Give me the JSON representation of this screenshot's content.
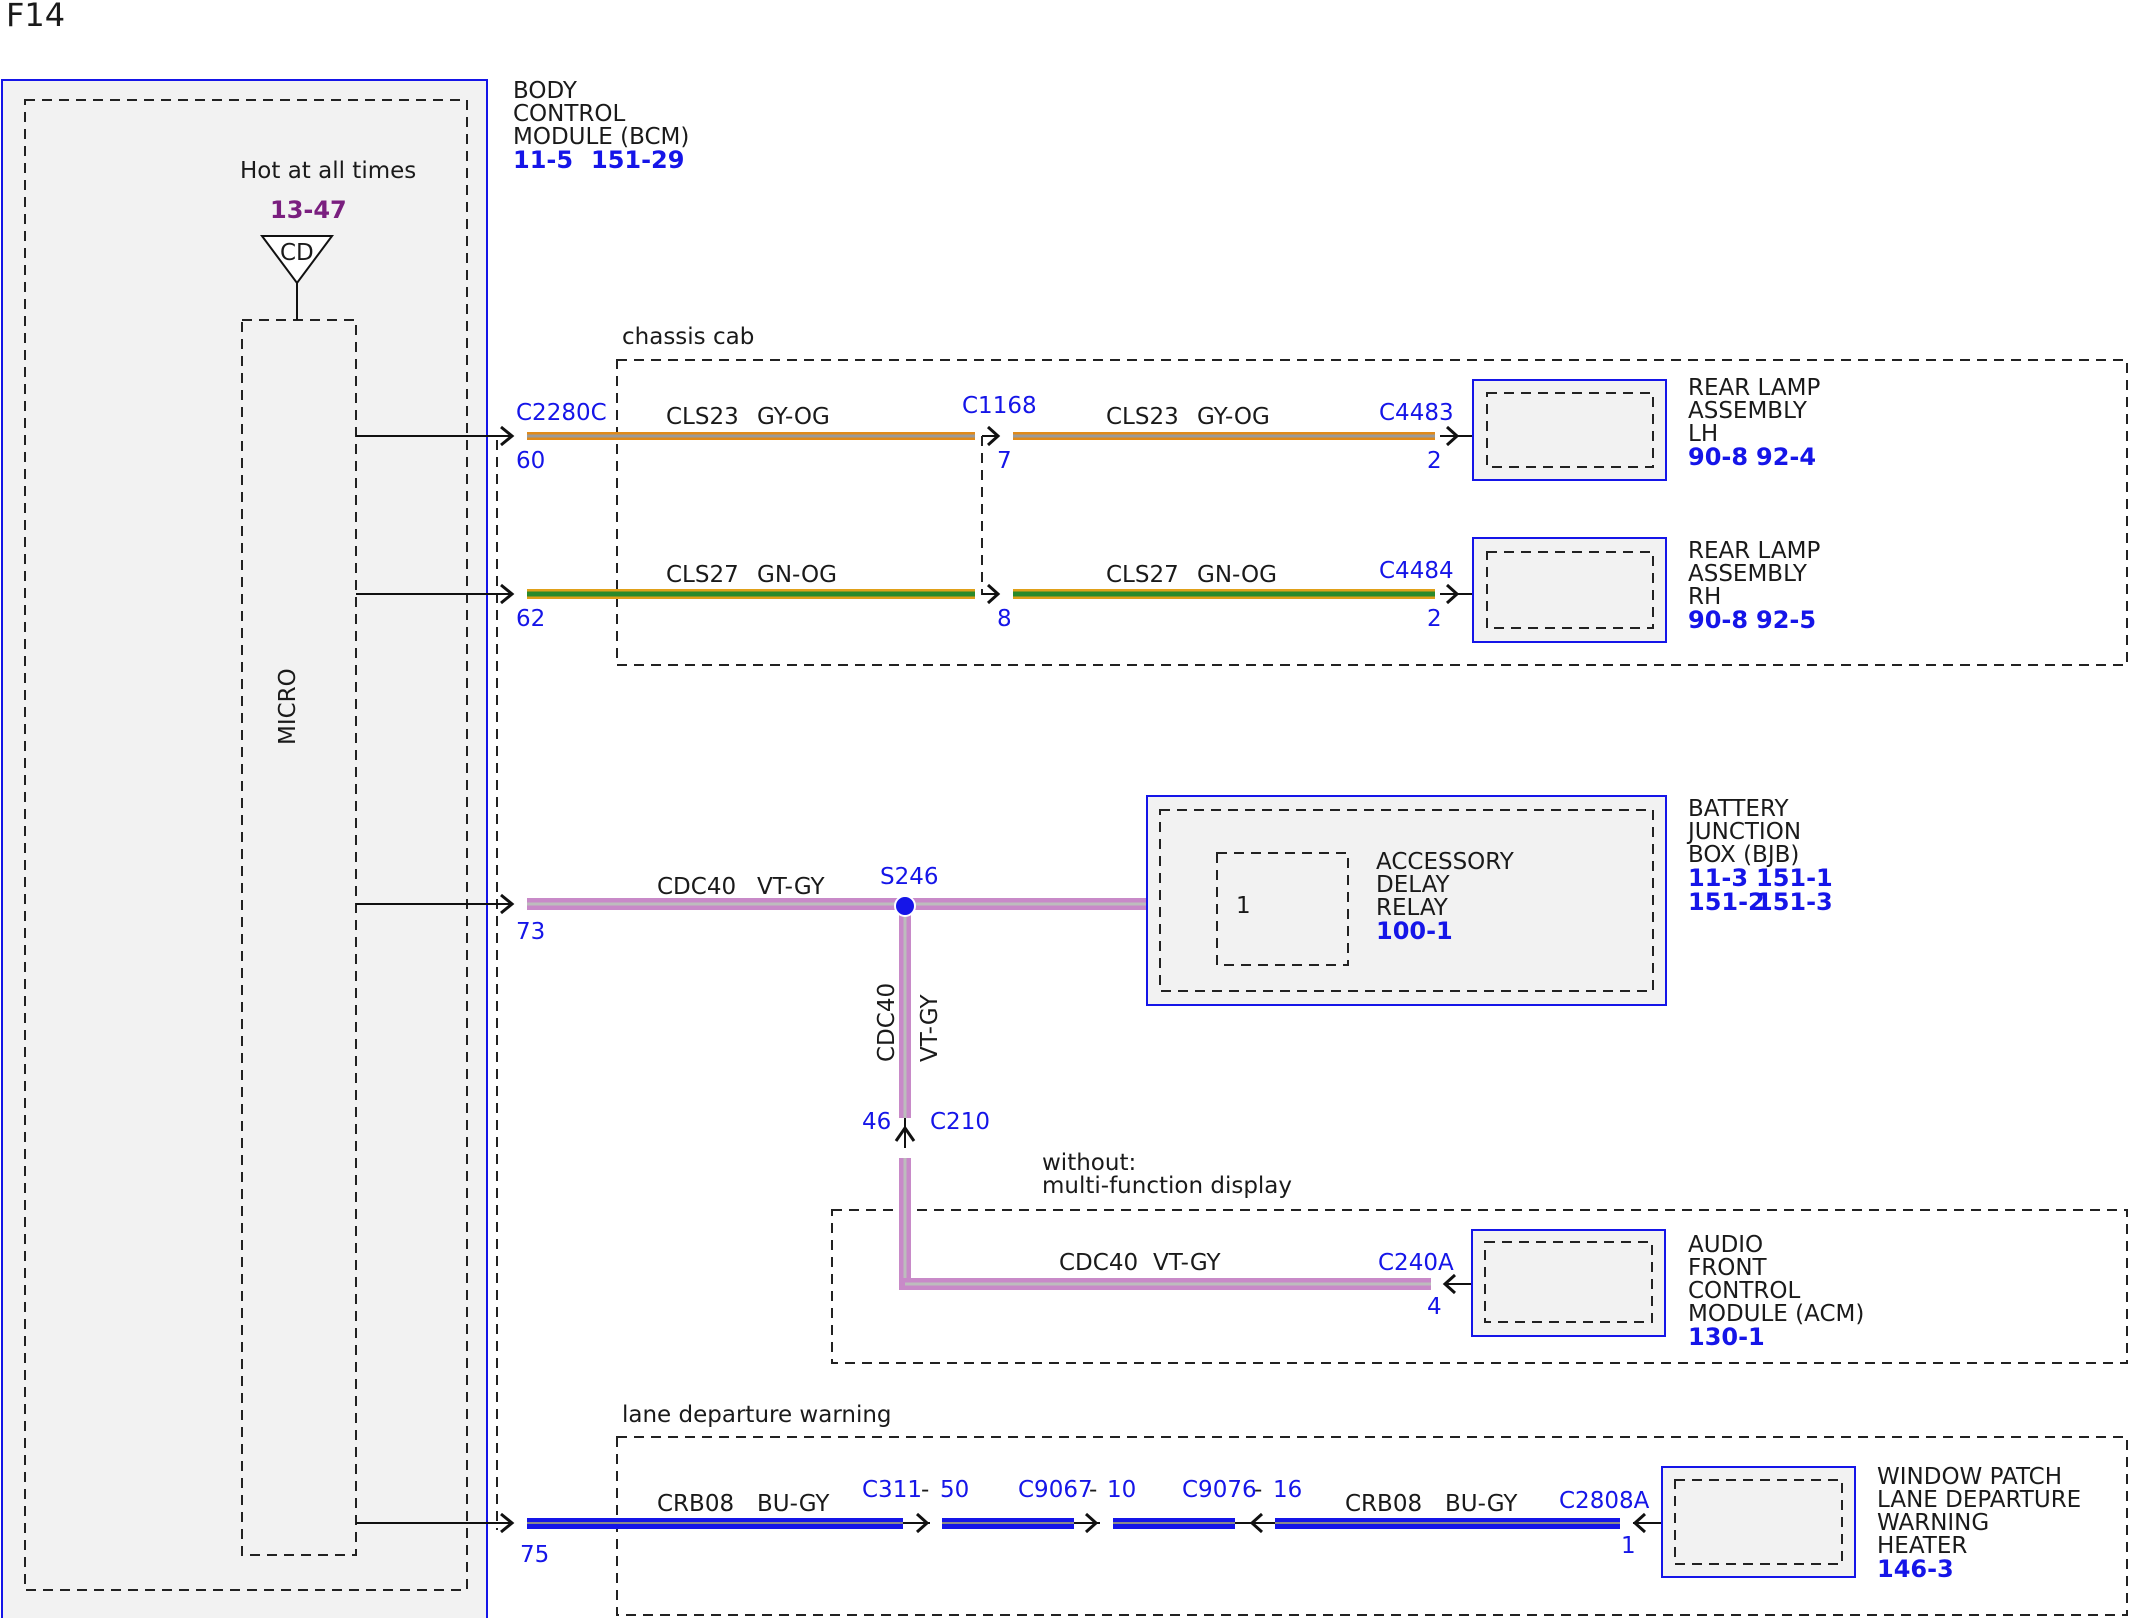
{
  "page_id": "F14",
  "bcm": {
    "title_lines": [
      "BODY",
      "CONTROL",
      "MODULE (BCM)"
    ],
    "refs": [
      "11-5",
      "151-29"
    ],
    "hot_label": "Hot at all times",
    "hot_ref": "13-47",
    "fuse_label": "CD",
    "micro_label": "MICRO"
  },
  "zones": {
    "chassis": "chassis cab",
    "without_lines": [
      "without:",
      "multi-function display"
    ],
    "lane": "lane departure warning"
  },
  "circuits": {
    "cls23": {
      "name": "CLS23",
      "color": "GY-OG"
    },
    "cls27": {
      "name": "CLS27",
      "color": "GN-OG"
    },
    "cdc40": {
      "name": "CDC40",
      "color": "VT-GY"
    },
    "crb08": {
      "name": "CRB08",
      "color": "BU-GY"
    }
  },
  "connectors": {
    "c2280c": "C2280C",
    "c1168": "C1168",
    "c4483": "C4483",
    "c4484": "C4484",
    "s246": "S246",
    "c210": "C210",
    "c240a": "C240A",
    "c311": "C311",
    "c9067": "C9067",
    "c9076": "C9076",
    "c2808a": "C2808A",
    "dash": "-"
  },
  "pins": {
    "p60": "60",
    "p62": "62",
    "p73": "73",
    "p75": "75",
    "p7": "7",
    "p8": "8",
    "p2a": "2",
    "p2b": "2",
    "p46": "46",
    "p4": "4",
    "p1": "1",
    "p50": "50",
    "p10": "10",
    "p16": "16",
    "relay_pin": "1"
  },
  "components": {
    "rear_lh": {
      "lines": [
        "REAR LAMP",
        "ASSEMBLY",
        "LH"
      ],
      "refs": [
        "90-8",
        "92-4"
      ]
    },
    "rear_rh": {
      "lines": [
        "REAR LAMP",
        "ASSEMBLY",
        "RH"
      ],
      "refs": [
        "90-8",
        "92-5"
      ]
    },
    "bjb": {
      "lines": [
        "BATTERY",
        "JUNCTION",
        "BOX (BJB)"
      ],
      "refs": [
        "11-3",
        "151-1",
        "151-2",
        "151-3"
      ]
    },
    "relay": {
      "lines": [
        "ACCESSORY",
        "DELAY",
        "RELAY"
      ],
      "ref": "100-1"
    },
    "acm": {
      "lines": [
        "AUDIO",
        "FRONT",
        "CONTROL",
        "MODULE (ACM)"
      ],
      "ref": "130-1"
    },
    "window": {
      "lines": [
        "WINDOW PATCH",
        "LANE DEPARTURE",
        "WARNING",
        "HEATER"
      ],
      "ref": "146-3"
    }
  },
  "colors": {
    "module_outline": "#1515e8",
    "module_fill": "#f2f2f2",
    "pin_blue": "#1515e8",
    "ref_purple": "#7a1f7f",
    "wire_gy_og": [
      "#9a9a9a",
      "#e08a1a"
    ],
    "wire_gn_og": [
      "#2a8a2a",
      "#e0a018"
    ],
    "wire_vt_gy": [
      "#c88ac8",
      "#bdbdbd"
    ],
    "wire_bu_gy": [
      "#1515e8",
      "#8a8a8a"
    ]
  }
}
